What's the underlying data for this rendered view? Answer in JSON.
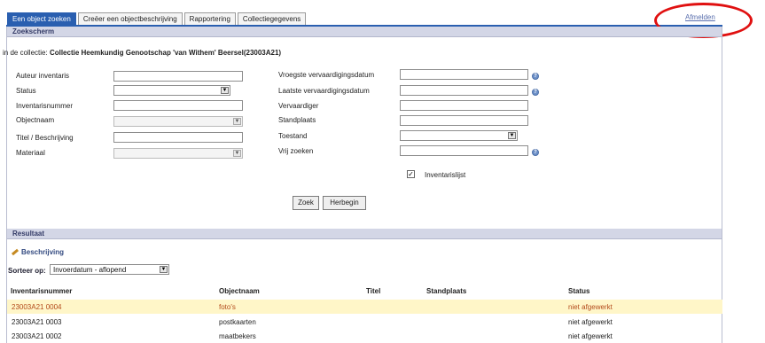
{
  "tabs": [
    {
      "label": "Een object zoeken"
    },
    {
      "label": "Creëer een objectbeschrijving"
    },
    {
      "label": "Rapportering"
    },
    {
      "label": "Collectiegegevens"
    }
  ],
  "logout_label": "Afmelden",
  "search_panel": {
    "title": "Zoekscherm",
    "collection_prefix": "in de collectie:",
    "collection_name": "Collectie Heemkundig Genootschap 'van Withem' Beersel(23003A21)",
    "fields_left": [
      {
        "label": "Auteur inventaris"
      },
      {
        "label": "Status"
      },
      {
        "label": "Inventarisnummer"
      },
      {
        "label": "Objectnaam"
      },
      {
        "label": "Titel / Beschrijving"
      },
      {
        "label": "Materiaal"
      }
    ],
    "fields_right": [
      {
        "label": "Vroegste vervaardigingsdatum"
      },
      {
        "label": "Laatste vervaardigingsdatum"
      },
      {
        "label": "Vervaardiger"
      },
      {
        "label": "Standplaats"
      },
      {
        "label": "Toestand"
      },
      {
        "label": "Vrij zoeken"
      }
    ],
    "checkbox_label": "Inventarislijst",
    "checkbox_checked": true,
    "search_button": "Zoek",
    "reset_button": "Herbegin"
  },
  "results_panel": {
    "title": "Resultaat",
    "describe_link": "Beschrijving",
    "sort_label": "Sorteer op:",
    "sort_value": "Invoerdatum - aflopend",
    "columns": [
      "Inventarisnummer",
      "Objectnaam",
      "Titel",
      "Standplaats",
      "Status"
    ],
    "rows": [
      {
        "inv": "23003A21  0004",
        "name": "foto's",
        "title": "",
        "place": "",
        "status": "niet afgewerkt"
      },
      {
        "inv": "23003A21  0003",
        "name": "postkaarten",
        "title": "",
        "place": "",
        "status": "niet afgewerkt"
      },
      {
        "inv": "23003A21  0002",
        "name": "maatbekers",
        "title": "",
        "place": "",
        "status": "niet afgewerkt"
      }
    ]
  },
  "colors": {
    "tab_active": "#2a5fb0",
    "panel_header": "#d3d6e6",
    "highlight_row": "#fff6c8",
    "annotation": "#e01010"
  }
}
